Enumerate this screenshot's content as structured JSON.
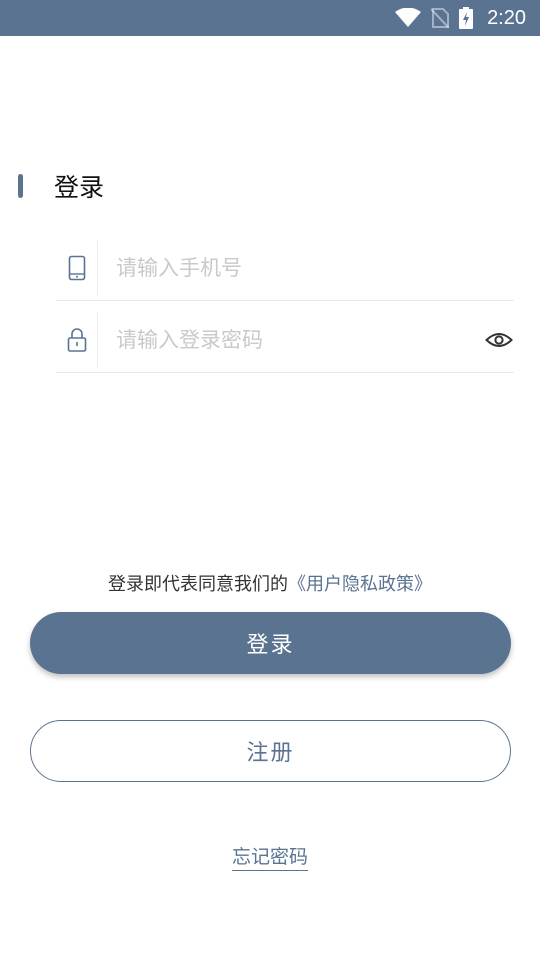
{
  "status_bar": {
    "time": "2:20",
    "icons": [
      "wifi-icon",
      "no-sim-icon",
      "battery-charging-icon"
    ],
    "background": "#5a7391"
  },
  "header": {
    "title": "登录"
  },
  "form": {
    "phone": {
      "placeholder": "请输入手机号",
      "value": "",
      "icon": "phone-icon"
    },
    "password": {
      "placeholder": "请输入登录密码",
      "value": "",
      "icon": "lock-icon",
      "toggle_icon": "eye-icon"
    }
  },
  "agreement": {
    "text": "登录即代表同意我们的",
    "link": "《用户隐私政策》"
  },
  "buttons": {
    "login": "登录",
    "register": "注册",
    "forgot": "忘记密码"
  },
  "colors": {
    "accent": "#5a7391"
  }
}
